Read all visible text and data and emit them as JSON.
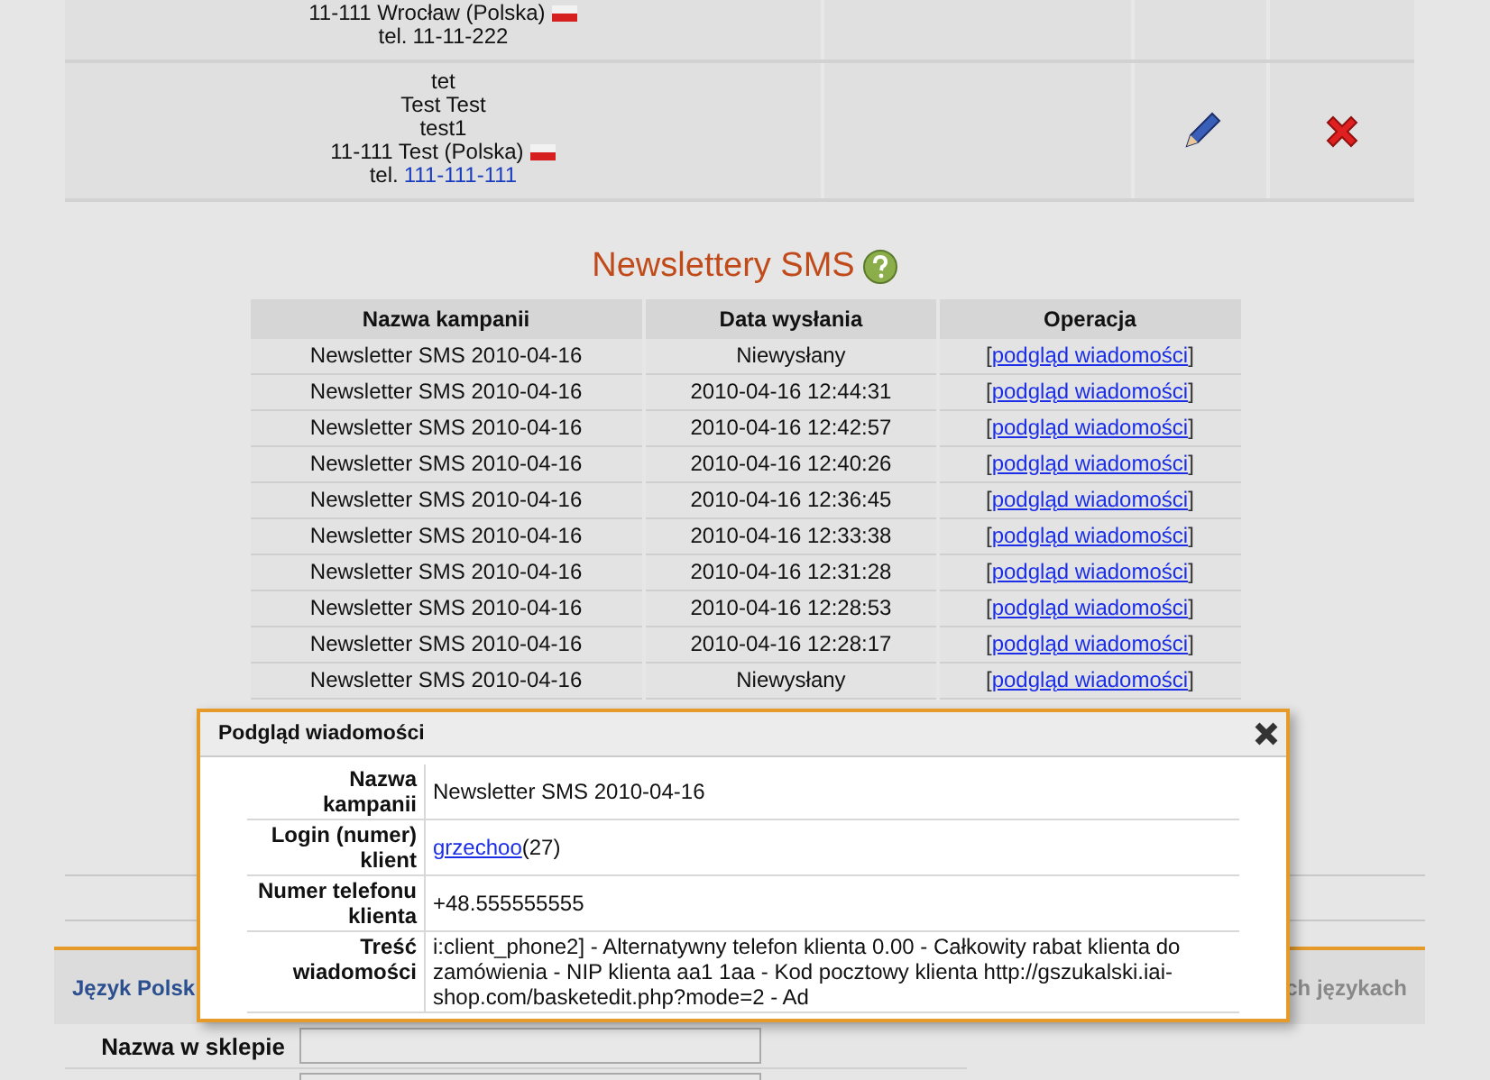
{
  "customers": [
    {
      "lines": [
        "11-111 Wrocław (Polska)"
      ],
      "phone_prefix": "tel. ",
      "phone": "11-11-222",
      "phone_link": false,
      "flag": true
    },
    {
      "lines": [
        "tet",
        "Test Test",
        "test1",
        "11-111 Test (Polska)"
      ],
      "phone_prefix": "tel. ",
      "phone": "111-111-111",
      "phone_link": true,
      "flag": true
    }
  ],
  "newsletter": {
    "title": "Newslettery SMS",
    "columns": [
      "Nazwa kampanii",
      "Data wysłania",
      "Operacja"
    ],
    "rows": [
      {
        "name": "Newsletter SMS 2010-04-16",
        "date": "Niewysłany",
        "open": "[",
        "action": "podgląd wiadomości",
        "close": "]"
      },
      {
        "name": "Newsletter SMS 2010-04-16",
        "date": "2010-04-16 12:44:31",
        "open": "[",
        "action": "podgląd wiadomości",
        "close": "]"
      },
      {
        "name": "Newsletter SMS 2010-04-16",
        "date": "2010-04-16 12:42:57",
        "open": "[",
        "action": "podgląd wiadomości",
        "close": "]"
      },
      {
        "name": "Newsletter SMS 2010-04-16",
        "date": "2010-04-16 12:40:26",
        "open": "[",
        "action": "podgląd wiadomości",
        "close": "]"
      },
      {
        "name": "Newsletter SMS 2010-04-16",
        "date": "2010-04-16 12:36:45",
        "open": "[",
        "action": "podgląd wiadomości",
        "close": "]"
      },
      {
        "name": "Newsletter SMS 2010-04-16",
        "date": "2010-04-16 12:33:38",
        "open": "[",
        "action": "podgląd wiadomości",
        "close": "]"
      },
      {
        "name": "Newsletter SMS 2010-04-16",
        "date": "2010-04-16 12:31:28",
        "open": "[",
        "action": "podgląd wiadomości",
        "close": "]"
      },
      {
        "name": "Newsletter SMS 2010-04-16",
        "date": "2010-04-16 12:28:53",
        "open": "[",
        "action": "podgląd wiadomości",
        "close": "]"
      },
      {
        "name": "Newsletter SMS 2010-04-16",
        "date": "2010-04-16 12:28:17",
        "open": "[",
        "action": "podgląd wiadomości",
        "close": "]"
      },
      {
        "name": "Newsletter SMS 2010-04-16",
        "date": "Niewysłany",
        "open": "[",
        "action": "podgląd wiadomości",
        "close": "]"
      }
    ]
  },
  "language_tabs": [
    {
      "label": "Język Polsk",
      "selected": true
    },
    {
      "label": "ch językach",
      "selected": false
    }
  ],
  "form": {
    "label": "Nazwa w sklepie"
  },
  "dialog": {
    "title": "Podgląd wiadomości",
    "fields": [
      {
        "kind": "text",
        "label": "Nazwa kampanii",
        "value": "Newsletter SMS 2010-04-16"
      },
      {
        "kind": "link",
        "label": "Login (numer) klient",
        "link": "grzechoo",
        "value": " (27)"
      },
      {
        "kind": "text",
        "label": "Numer telefonu klienta",
        "value": "+48.555555555"
      },
      {
        "kind": "text",
        "label": "Treść wiadomości",
        "value": "i:client_phone2] - Alternatywny telefon klienta 0.00 - Całkowity rabat klienta do zamówienia - NIP klienta aa1 1aa - Kod pocztowy klienta http://gszukalski.iai-shop.com/basketedit.php?mode=2 - Ad"
      }
    ]
  }
}
